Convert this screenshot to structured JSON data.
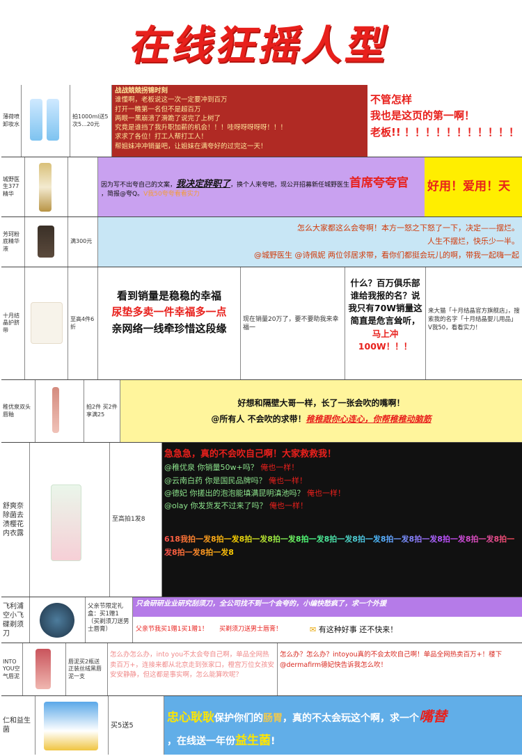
{
  "page": {
    "title": "在线狂摇人型"
  },
  "rows": [
    {
      "name": "薄荷喷卸妆水",
      "price": "拍1000ml送5次5...20元",
      "copy": [
        "战战兢兢拐锦时刻",
        "谁懂啊，老板说这一次一定要冲到百万",
        "打开一瞧第一名但不是超百万",
        "两眼一黑崩溃了滑跪了说完了上树了",
        "究竟是谁挡了我升职加薪的机会！！！哇呀呀呀呀呀！！！",
        "求求了各位！打工人帮打工人！",
        "帮姐妹冲冲销量吧，让姐妹在满夸好的过完这一天！"
      ],
      "resp": [
        "不管怎样",
        "我也是这页的第一啊！",
        "老板!! ！！！！！！！！！！！"
      ]
    },
    {
      "name": "城野医生377精华",
      "price": "",
      "copy_lead": "因为写不出夸自己的文案，",
      "copy_em": "我决定辞职了",
      "copy_mid": "，换个人来夸吧，现公开招募新任城野医生",
      "copy_big": "首席夸夸官",
      "copy_tail": "，简报@夸Q。",
      "copy_tail2": "V我50夸夸看看实力",
      "resp": "好用！爱用！天"
    },
    {
      "name": "芳珂粉底精华液",
      "price": "满300元",
      "lines": [
        "怎么大家都这么会夸啊！本方一怒之下怒了一下，决定——摆烂。",
        "人生不摆烂，快乐少一半。",
        "@城野医生 @诗佩妮 两位邻居求带，看你们都挺会玩儿的啊，带我一起嗨一起"
      ]
    },
    {
      "name": "十月结晶护脐带",
      "price": "至高4件6折",
      "c1": [
        "看到销量是稳稳的幸福",
        "尿垫多卖一件幸福多一点",
        "亲网络一线牵珍惜这段缘"
      ],
      "c2": "现在销量20万了，要不要助我来幸福一",
      "c3a": "什么？百万俱乐部谁给我报的名？说我只有70W销量这简直是危言耸听，",
      "c3b": "马上冲100W！！！",
      "c4": "来大猫「十月结晶官方旗舰店」，搜索我的名字「十月结晶婴儿用品」V我50，看看实力！"
    },
    {
      "name": "稚优泉双头唇釉",
      "price": "拍2件 买2件享满25",
      "line1": "好想和隔壁大哥一样，长了一张会吹的嘴啊！",
      "line2a": "@所有人 不会吹的求带！",
      "line2b": "稚稚跟你心连心，你帮稚稚动脑筋"
    },
    {
      "name": "舒爽奈除菌去渍樱花内衣露",
      "price": "至高拍1发8",
      "head": "急急急，真的不会吹自己啊！大家救救我！",
      "lines": [
        {
          "a": "@稚优泉 你销量50w+吗？",
          "b": "俺也一样！"
        },
        {
          "a": "@云南白药 你是国民品牌吗？",
          "b": "俺也一样！"
        },
        {
          "a": "@德妃 你搓出的泡泡能填满昆明滇池吗？",
          "b": "俺也一样！"
        },
        {
          "a": "@olay 你发货发不过来了吗？",
          "b": "俺也一样！"
        }
      ],
      "promo": "618我拍一发8拍一发8拍一发8拍一发8拍一发8拍一发8拍一发8拍一发8拍一发8拍一发8拍一发8拍一发8拍一发8拍一发8"
    },
    {
      "name": "飞利浦空小飞碟剃须刀",
      "price": "父亲节限定礼盒：买1赠1（买剃须刀送男士唇膏）",
      "top": "只会研研业业研究刮须刀，全公司找不到一个会夸的，小编快愁疯了，求一个外援",
      "b1": "父亲节我买1赠1买1赠1！",
      "b2": "买剃须刀送男士唇膏！",
      "b3": "有这种好事 还不快来！"
    },
    {
      "name": "INTO YOU空气唇泥",
      "price": "唇泥买2瓶送正装丝绒黑唇泥一支",
      "left": "怎么办怎么办，into you不太会夸自己啊，单品全网热卖百万+，连接来都从北京走到张家口，橙宫万位女孩安安安静静，但这都是事实啊，怎么能算吹呢？",
      "right": "怎么办？怎么办？intoyou真的不会太吹自己啊！单品全网热卖百万+！楼下@dermafirm德妃快告诉我怎么吹！"
    },
    {
      "name": "仁和益生菌",
      "price": "买5送5",
      "l1a": "忠心耿耿",
      "l1b": "保护你们的",
      "l1c": "肠胃",
      "l1d": "，真的不太会玩这个啊，求一个",
      "l1e": "嘴替",
      "l2a": "，在线送一年份",
      "l2b": "益生菌",
      "l2c": "!"
    }
  ],
  "colors": {
    "red": "#e8201c",
    "dark_red": "#b02a24",
    "purple": "#c9a1f0",
    "yellow": "#ffee00",
    "light_blue": "#c8e6f5",
    "pale_yellow": "#fff59c",
    "black": "#111111",
    "violet": "#b57be8",
    "blue": "#61aee8"
  }
}
